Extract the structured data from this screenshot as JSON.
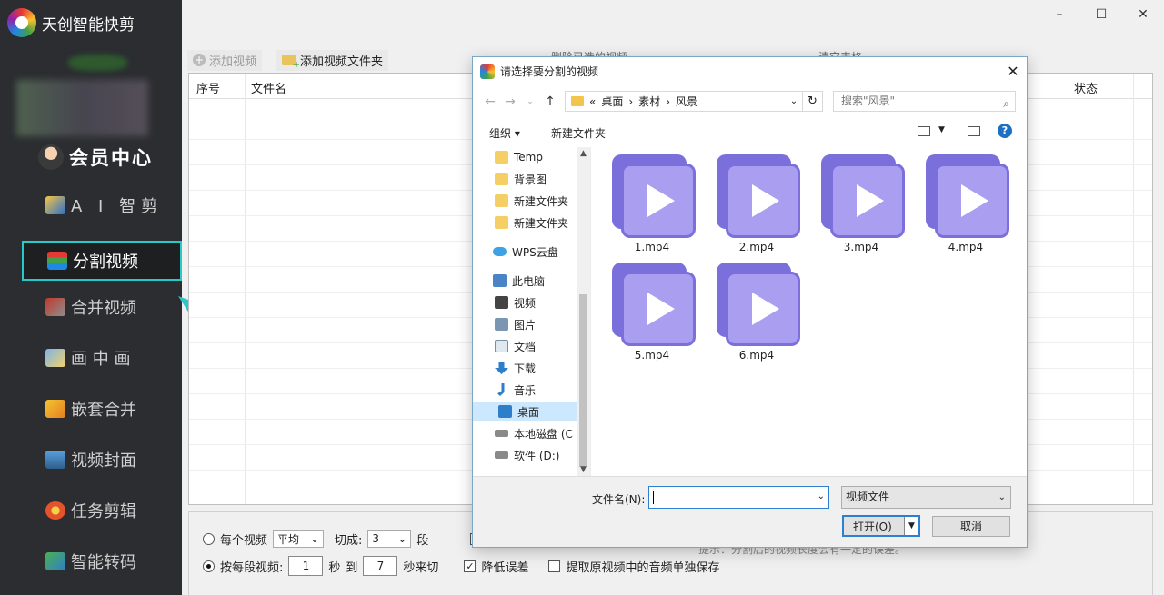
{
  "app": {
    "title": "天创智能快剪",
    "member_center": "会员中心"
  },
  "sidebar": {
    "items": [
      {
        "label": "A I 智剪"
      },
      {
        "label": "分割视频"
      },
      {
        "label": "合并视频"
      },
      {
        "label": "画 中 画"
      },
      {
        "label": "嵌套合并"
      },
      {
        "label": "视频封面"
      },
      {
        "label": "任务剪辑"
      },
      {
        "label": "智能转码"
      }
    ]
  },
  "window": {
    "minimize": "–",
    "maximize": "☐",
    "close": "✕"
  },
  "toolbar": {
    "add_video": "添加视频",
    "add_folder": "添加视频文件夹",
    "delete_selected": "删除已选的视频",
    "clear_table": "清空表格"
  },
  "table": {
    "columns": {
      "index": "序号",
      "filename": "文件名",
      "status": "状态"
    }
  },
  "bottom": {
    "each_video": "每个视频",
    "mode_value": "平均",
    "cut_into": "切成:",
    "segments_value": "3",
    "segments_unit": "段",
    "per_segment": "按每段视频:",
    "from_value": "1",
    "sec": "秒",
    "to": "到",
    "to_value": "7",
    "sec_cut": "秒来切",
    "reduce_error": "降低误差",
    "extract_audio": "提取原视频中的音频单独保存",
    "hint": "提示：分割后的视频长度会有一定的误差。"
  },
  "dialog": {
    "title": "请选择要分割的视频",
    "breadcrumb": {
      "overflow": "«",
      "parts": [
        "桌面",
        "素材",
        "风景"
      ],
      "sep": "›"
    },
    "search_placeholder": "搜索\"风景\"",
    "organize": "组织 ▾",
    "new_folder": "新建文件夹",
    "help": "?",
    "tree": [
      {
        "label": "Temp"
      },
      {
        "label": "背景图"
      },
      {
        "label": "新建文件夹"
      },
      {
        "label": "新建文件夹"
      },
      {
        "label": "WPS云盘"
      },
      {
        "label": "此电脑"
      },
      {
        "label": "视频"
      },
      {
        "label": "图片"
      },
      {
        "label": "文档"
      },
      {
        "label": "下载"
      },
      {
        "label": "音乐"
      },
      {
        "label": "桌面"
      },
      {
        "label": "本地磁盘 (C"
      },
      {
        "label": "软件 (D:)"
      }
    ],
    "files": [
      "1.mp4",
      "2.mp4",
      "3.mp4",
      "4.mp4",
      "5.mp4",
      "6.mp4"
    ],
    "filename_label": "文件名(N):",
    "filename_value": "",
    "filetype_value": "视频文件",
    "open_label": "打开(O)",
    "cancel_label": "取消"
  }
}
